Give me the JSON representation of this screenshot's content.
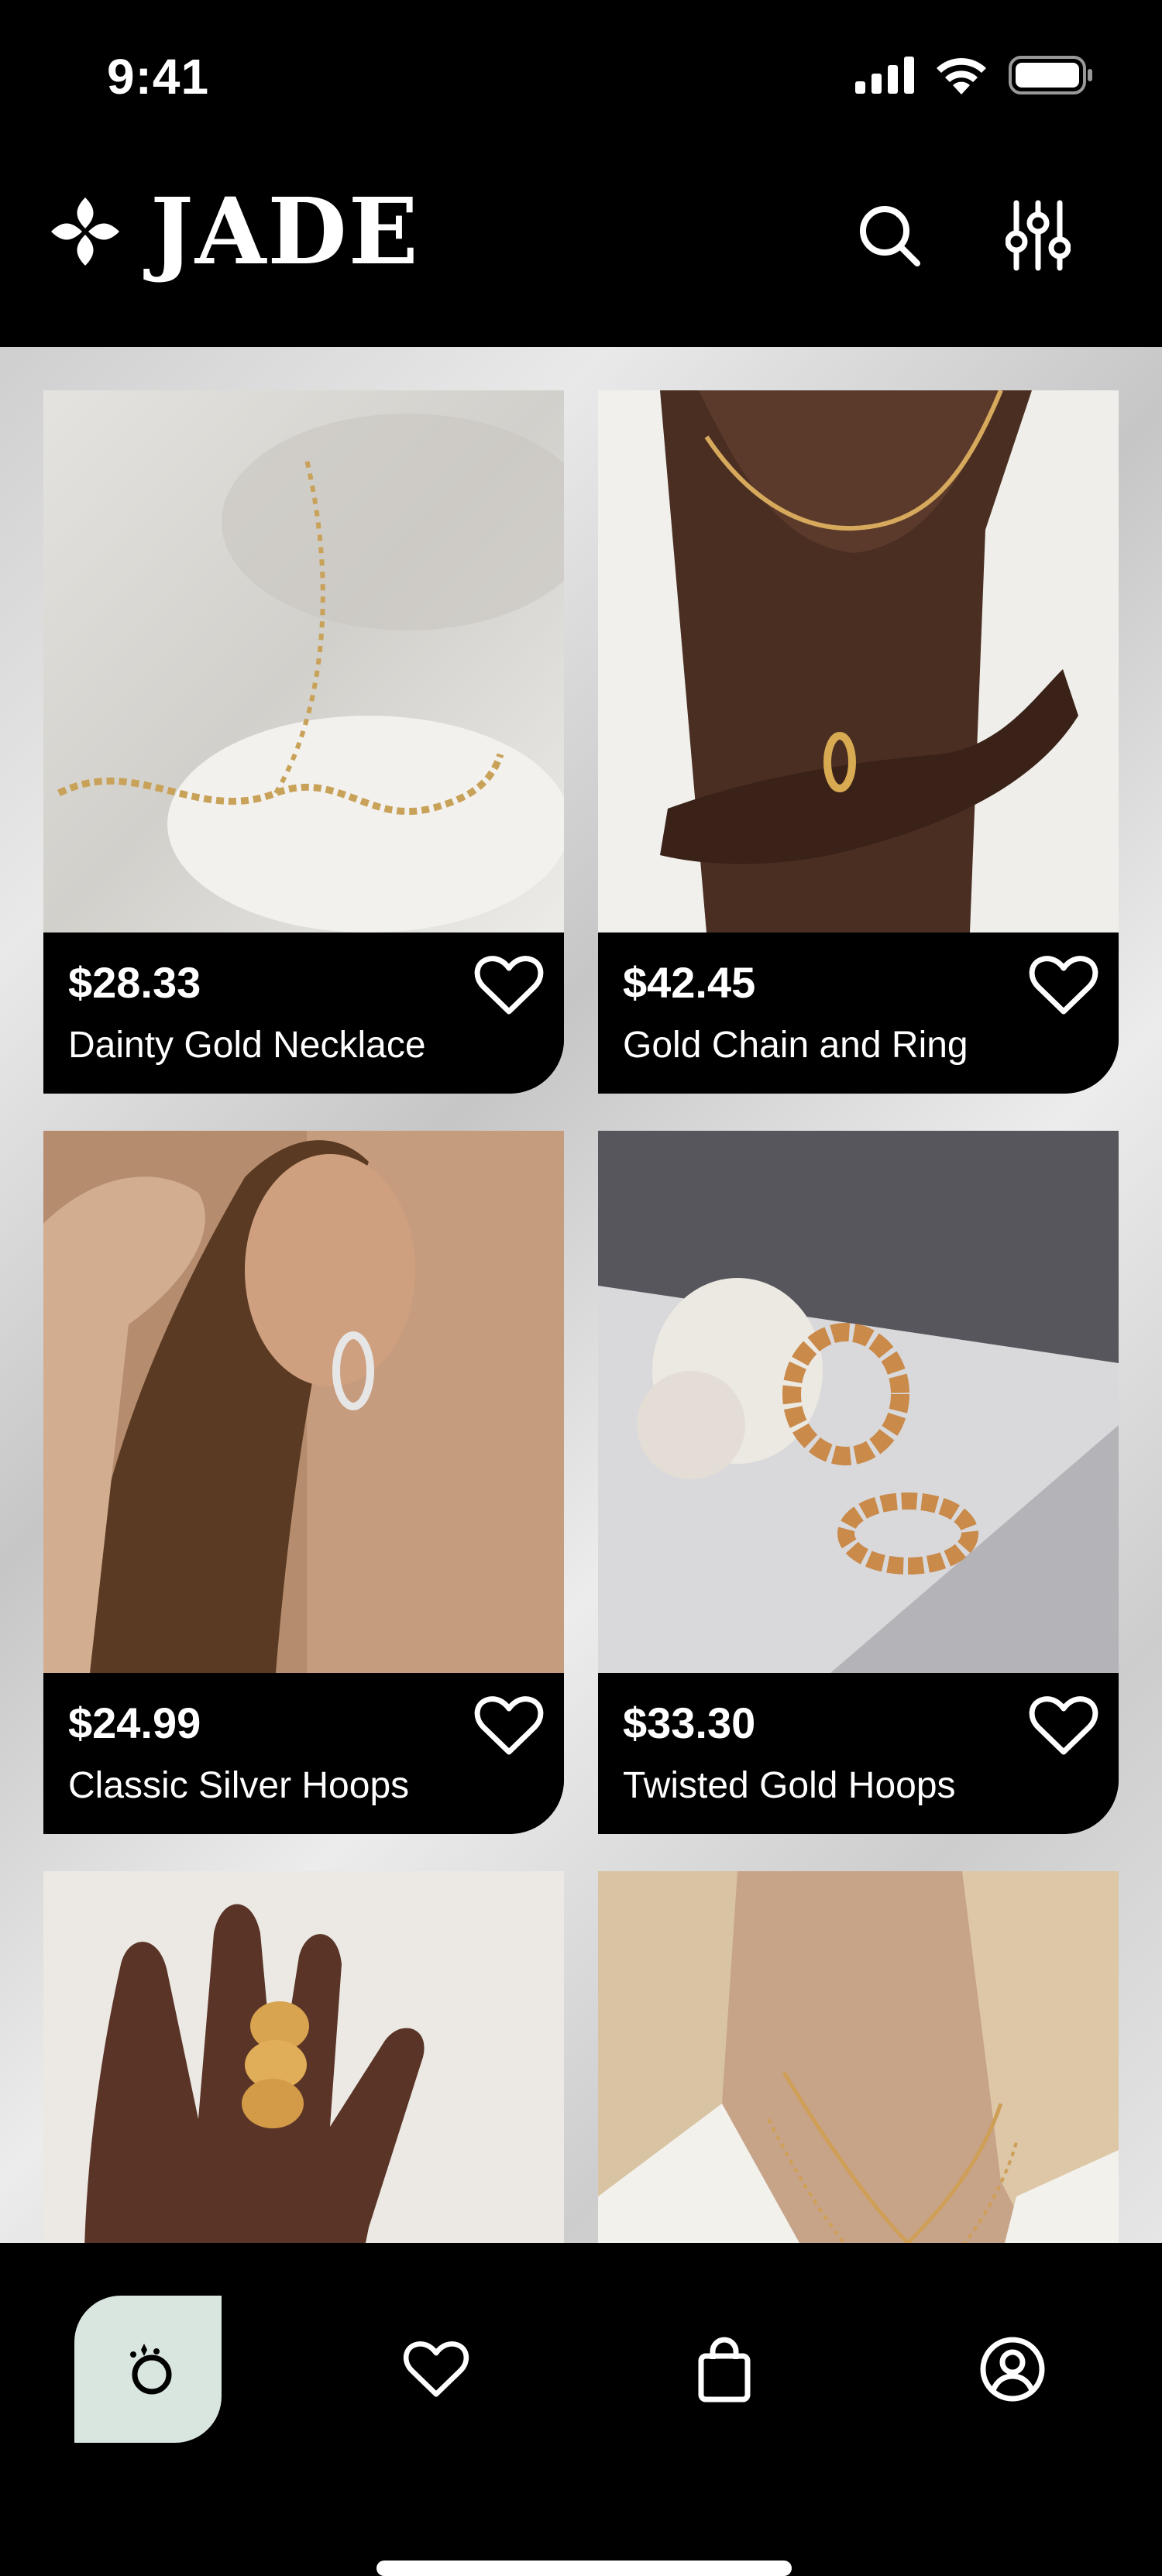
{
  "status_bar": {
    "time": "9:41"
  },
  "header": {
    "brand": "JADE",
    "icons": [
      "clover-logo-icon",
      "search-icon",
      "filter-sliders-icon"
    ]
  },
  "products": [
    {
      "price": "$28.33",
      "name": "Dainty Gold Necklace"
    },
    {
      "price": "$42.45",
      "name": "Gold Chain and Ring"
    },
    {
      "price": "$24.99",
      "name": "Classic Silver Hoops"
    },
    {
      "price": "$33.30",
      "name": "Twisted Gold Hoops"
    },
    {
      "price": "",
      "name": ""
    },
    {
      "price": "",
      "name": ""
    }
  ],
  "tabs": [
    {
      "icon": "ring-icon",
      "active": true
    },
    {
      "icon": "heart-icon",
      "active": false
    },
    {
      "icon": "shopping-bag-icon",
      "active": false
    },
    {
      "icon": "account-icon",
      "active": false
    }
  ],
  "colors": {
    "background": "#000000",
    "active_tab": "#d9e6df",
    "text": "#ffffff"
  }
}
